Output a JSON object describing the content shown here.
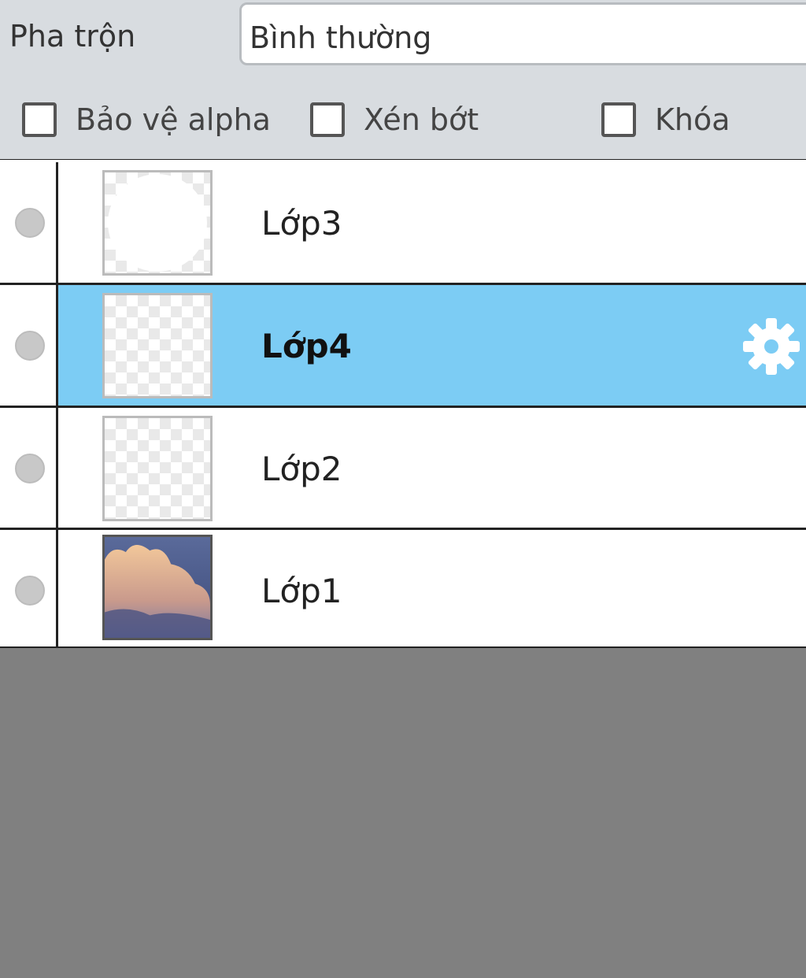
{
  "blend": {
    "label": "Pha trộn",
    "value": "Bình thường"
  },
  "options": {
    "protect_alpha": {
      "label": "Bảo vệ alpha",
      "checked": false
    },
    "clip": {
      "label": "Xén bớt",
      "checked": false
    },
    "lock": {
      "label": "Khóa",
      "checked": false
    }
  },
  "layers": [
    {
      "name": "Lớp3",
      "selected": false,
      "thumbnail": "transparent-with-white-circle"
    },
    {
      "name": "Lớp4",
      "selected": true,
      "thumbnail": "transparent",
      "action_icon": "gear-icon"
    },
    {
      "name": "Lớp2",
      "selected": false,
      "thumbnail": "transparent"
    },
    {
      "name": "Lớp1",
      "selected": false,
      "thumbnail": "sky-clouds"
    }
  ],
  "colors": {
    "selected_row": "#7cccf4",
    "panel_bg": "#d8dce0",
    "empty_bg": "#808080"
  }
}
